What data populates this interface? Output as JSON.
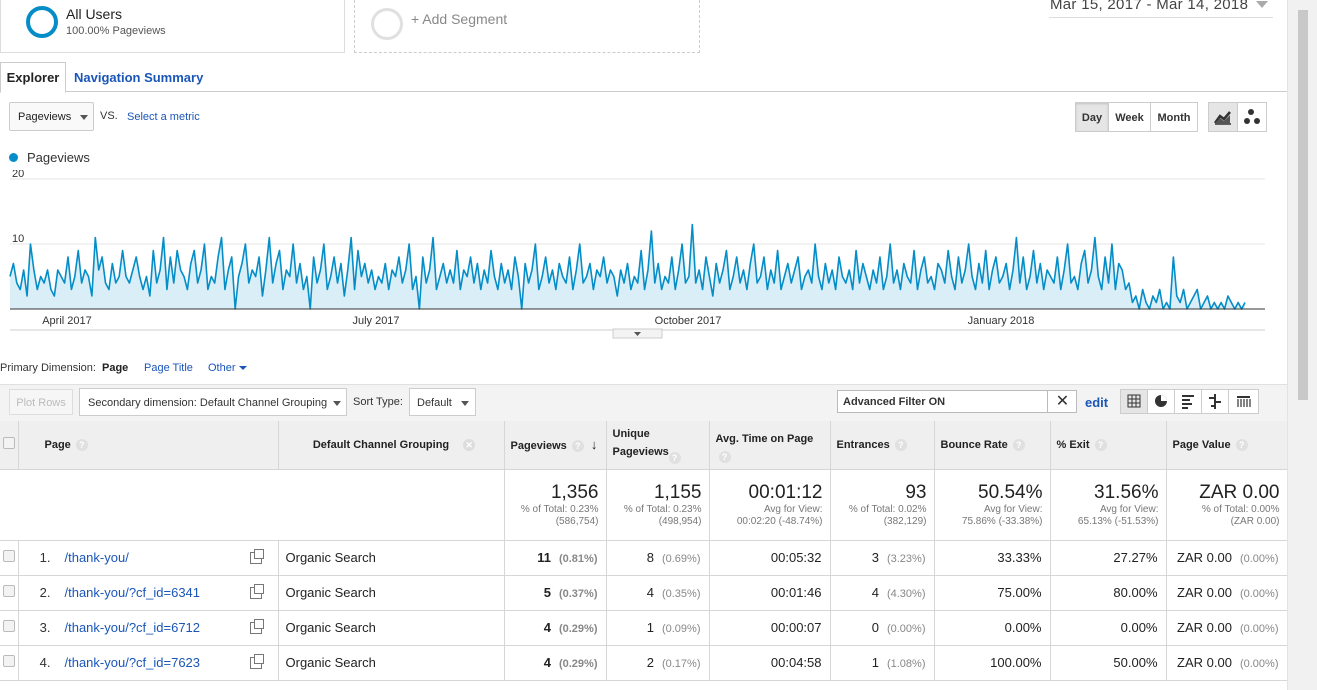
{
  "segments": {
    "all_users": {
      "title": "All Users",
      "subtitle": "100.00% Pageviews"
    },
    "add_segment": "+ Add Segment"
  },
  "date_range": "Mar 15, 2017 - Mar 14, 2018",
  "tabs": {
    "explorer": "Explorer",
    "navigation_summary": "Navigation Summary"
  },
  "metric": {
    "selected": "Pageviews",
    "vs": "VS.",
    "select_metric": "Select a metric"
  },
  "granularity": {
    "day": "Day",
    "week": "Week",
    "month": "Month",
    "active": "Day"
  },
  "chart_view_icons": [
    "line-chart-icon",
    "motion-chart-icon"
  ],
  "colors": {
    "series": "#058dc7",
    "fill": "#d9eef7",
    "link": "#1a56b8"
  },
  "chart_data": {
    "type": "area",
    "series": [
      {
        "name": "Pageviews",
        "values": [
          5,
          7,
          4,
          3,
          6,
          2,
          10,
          6,
          3,
          5,
          4,
          6,
          3,
          2,
          6,
          5,
          4,
          8,
          3,
          5,
          9,
          4,
          6,
          5,
          2,
          11,
          6,
          8,
          4,
          3,
          7,
          4,
          5,
          9,
          5,
          4,
          6,
          8,
          5,
          3,
          5,
          2,
          9,
          4,
          6,
          11,
          3,
          8,
          4,
          9,
          6,
          5,
          3,
          7,
          9,
          4,
          6,
          10,
          3,
          5,
          4,
          8,
          11,
          3,
          6,
          8,
          0,
          5,
          7,
          10,
          4,
          6,
          5,
          8,
          2,
          6,
          11,
          4,
          7,
          9,
          3,
          6,
          5,
          10,
          4,
          7,
          3,
          5,
          0,
          8,
          4,
          6,
          10,
          3,
          5,
          8,
          4,
          7,
          2,
          6,
          11,
          3,
          9,
          5,
          7,
          4,
          6,
          3,
          5,
          4,
          7,
          3,
          6,
          5,
          8,
          4,
          6,
          10,
          3,
          5,
          0,
          8,
          4,
          6,
          11,
          3,
          5,
          7,
          4,
          6,
          4,
          9,
          3,
          6,
          5,
          8,
          4,
          7,
          3,
          6,
          4,
          9,
          5,
          3,
          7,
          4,
          6,
          3,
          8,
          5,
          0,
          7,
          4,
          6,
          10,
          3,
          5,
          8,
          4,
          6,
          3,
          7,
          5,
          4,
          8,
          3,
          6,
          10,
          4,
          5,
          7,
          3,
          6,
          5,
          8,
          4,
          6,
          5,
          2,
          6,
          4,
          7,
          3,
          5,
          4,
          9,
          3,
          6,
          12,
          4,
          7,
          3,
          5,
          4,
          8,
          3,
          6,
          10,
          4,
          5,
          13,
          4,
          6,
          3,
          8,
          5,
          2,
          7,
          4,
          6,
          9,
          3,
          5,
          8,
          4,
          6,
          3,
          7,
          10,
          4,
          5,
          8,
          3,
          6,
          4,
          9,
          3,
          5,
          7,
          4,
          6,
          8,
          3,
          5,
          6,
          4,
          10,
          5,
          3,
          7,
          4,
          6,
          3,
          8,
          5,
          4,
          6,
          3,
          9,
          4,
          7,
          5,
          3,
          6,
          4,
          8,
          3,
          5,
          10,
          4,
          6,
          3,
          7,
          5,
          4,
          9,
          3,
          6,
          8,
          4,
          5,
          3,
          7,
          6,
          4,
          9,
          5,
          3,
          8,
          4,
          6,
          10,
          5,
          3,
          7,
          4,
          9,
          3,
          6,
          8,
          4,
          5,
          7,
          3,
          6,
          11,
          4,
          8,
          3,
          5,
          9,
          4,
          7,
          3,
          6,
          5,
          4,
          8,
          3,
          6,
          10,
          4,
          5,
          3,
          7,
          9,
          4,
          6,
          11,
          5,
          3,
          8,
          4,
          10,
          3,
          7,
          6,
          3,
          4,
          1,
          2,
          0,
          3,
          1,
          0,
          2,
          1,
          3,
          0,
          1,
          0,
          8,
          2,
          1,
          3,
          0,
          1,
          2,
          3,
          0,
          1,
          2,
          0,
          1,
          0,
          1,
          0,
          2,
          1,
          0,
          1,
          0,
          1
        ]
      }
    ],
    "x_ticks": [
      "April 2017",
      "July 2017",
      "October 2017",
      "January 2018"
    ],
    "y_ticks": [
      10,
      20
    ],
    "ylim": [
      0,
      20
    ],
    "grid": true
  },
  "primary_dimension": {
    "label": "Primary Dimension:",
    "options": [
      "Page",
      "Page Title",
      "Other"
    ],
    "selected": "Page"
  },
  "toolbar": {
    "plot_rows": "Plot Rows",
    "secondary_dimension": "Secondary dimension: Default Channel Grouping",
    "sort_type_label": "Sort Type:",
    "sort_type_value": "Default",
    "filter_value": "Advanced Filter ON",
    "edit": "edit",
    "view_icons": [
      "data-table-icon",
      "pie-chart-icon",
      "performance-icon",
      "comparison-icon",
      "term-cloud-icon"
    ]
  },
  "table": {
    "headers": {
      "page": "Page",
      "channel": "Default Channel Grouping",
      "pageviews": "Pageviews",
      "unique_pageviews": "Unique Pageviews",
      "avg_time": "Avg. Time on Page",
      "entrances": "Entrances",
      "bounce_rate": "Bounce Rate",
      "exit": "% Exit",
      "page_value": "Page Value"
    },
    "totals": {
      "pageviews": {
        "value": "1,356",
        "sub1": "% of Total: 0.23%",
        "sub2": "(586,754)"
      },
      "unique_pageviews": {
        "value": "1,155",
        "sub1": "% of Total: 0.23%",
        "sub2": "(498,954)"
      },
      "avg_time": {
        "value": "00:01:12",
        "sub1": "Avg for View:",
        "sub2": "00:02:20 (-48.74%)"
      },
      "entrances": {
        "value": "93",
        "sub1": "% of Total: 0.02%",
        "sub2": "(382,129)"
      },
      "bounce_rate": {
        "value": "50.54%",
        "sub1": "Avg for View:",
        "sub2": "75.86% (-33.38%)"
      },
      "exit": {
        "value": "31.56%",
        "sub1": "Avg for View:",
        "sub2": "65.13% (-51.53%)"
      },
      "page_value": {
        "value": "ZAR 0.00",
        "sub1": "% of Total: 0.00%",
        "sub2": "(ZAR 0.00)"
      }
    },
    "rows": [
      {
        "num": "1.",
        "page": "/thank-you/",
        "channel": "Organic Search",
        "pageviews": "11",
        "pageviews_pct": "(0.81%)",
        "unique": "8",
        "unique_pct": "(0.69%)",
        "avg_time": "00:05:32",
        "entrances": "3",
        "entrances_pct": "(3.23%)",
        "bounce": "33.33%",
        "exit": "27.27%",
        "value": "ZAR 0.00",
        "value_pct": "(0.00%)"
      },
      {
        "num": "2.",
        "page": "/thank-you/?cf_id=6341",
        "channel": "Organic Search",
        "pageviews": "5",
        "pageviews_pct": "(0.37%)",
        "unique": "4",
        "unique_pct": "(0.35%)",
        "avg_time": "00:01:46",
        "entrances": "4",
        "entrances_pct": "(4.30%)",
        "bounce": "75.00%",
        "exit": "80.00%",
        "value": "ZAR 0.00",
        "value_pct": "(0.00%)"
      },
      {
        "num": "3.",
        "page": "/thank-you/?cf_id=6712",
        "channel": "Organic Search",
        "pageviews": "4",
        "pageviews_pct": "(0.29%)",
        "unique": "1",
        "unique_pct": "(0.09%)",
        "avg_time": "00:00:07",
        "entrances": "0",
        "entrances_pct": "(0.00%)",
        "bounce": "0.00%",
        "exit": "0.00%",
        "value": "ZAR 0.00",
        "value_pct": "(0.00%)"
      },
      {
        "num": "4.",
        "page": "/thank-you/?cf_id=7623",
        "channel": "Organic Search",
        "pageviews": "4",
        "pageviews_pct": "(0.29%)",
        "unique": "2",
        "unique_pct": "(0.17%)",
        "avg_time": "00:04:58",
        "entrances": "1",
        "entrances_pct": "(1.08%)",
        "bounce": "100.00%",
        "exit": "50.00%",
        "value": "ZAR 0.00",
        "value_pct": "(0.00%)"
      }
    ]
  }
}
